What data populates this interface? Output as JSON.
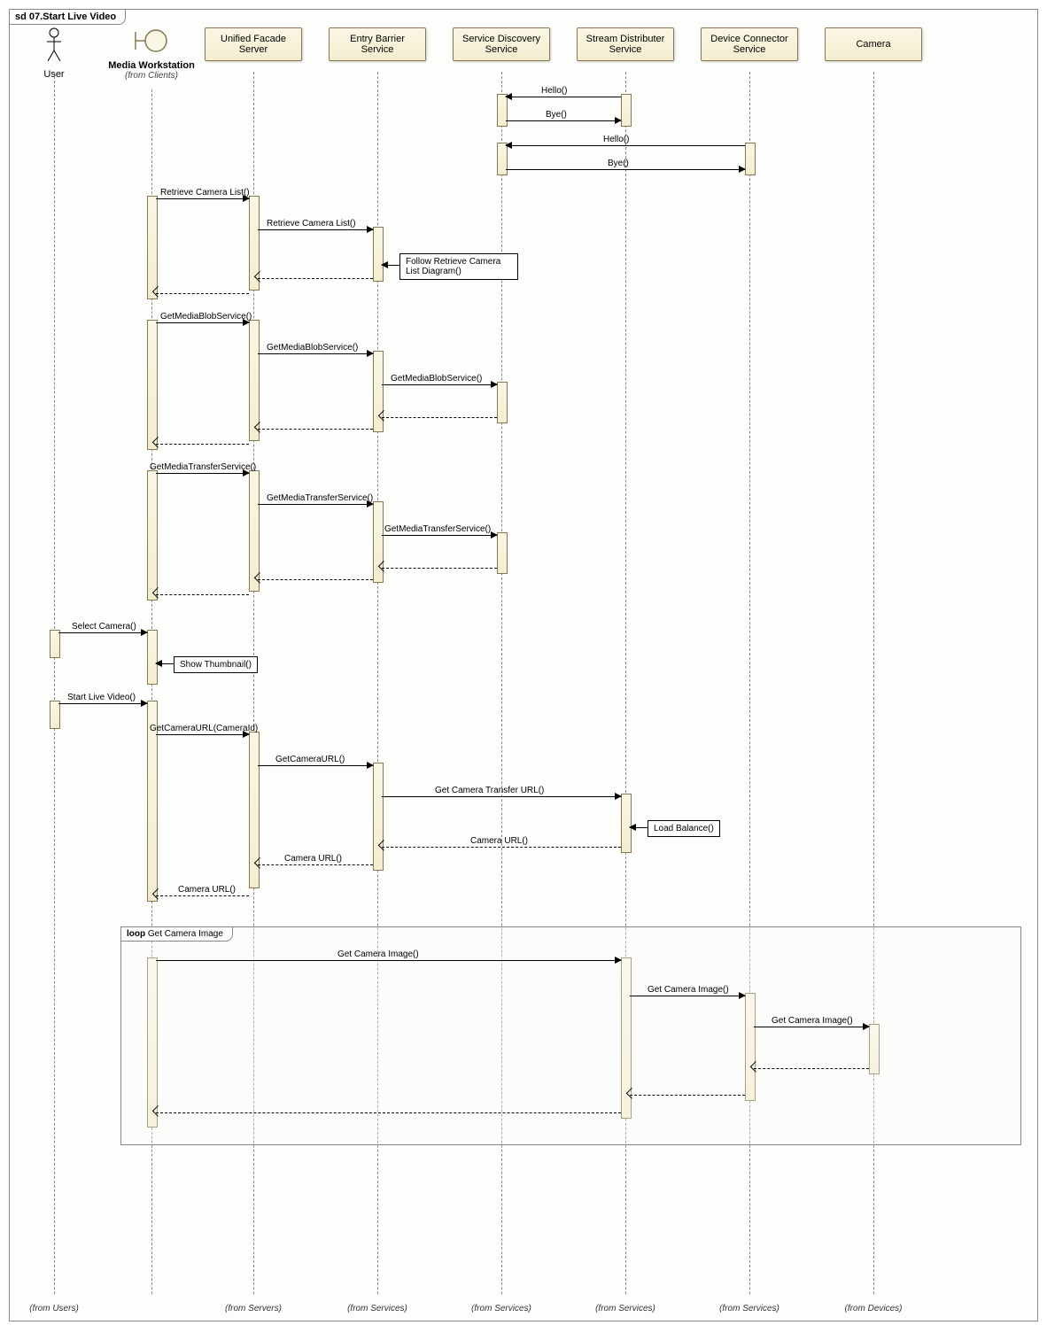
{
  "frame_title": "sd 07.Start Live Video",
  "lifelines": [
    {
      "name": "User",
      "from": "(from Users)"
    },
    {
      "name": "Media Workstation",
      "stereotype": "(from Clients)",
      "from": ""
    },
    {
      "name": "Unified Facade Server",
      "from": "(from Servers)"
    },
    {
      "name": "Entry Barrier Service",
      "from": "(from Services)"
    },
    {
      "name": "Service Discovery Service",
      "from": "(from Services)"
    },
    {
      "name": "Stream Distributer Service",
      "from": "(from Services)"
    },
    {
      "name": "Device Connector Service",
      "from": "(from Services)"
    },
    {
      "name": "Camera",
      "from": "(from Devices)"
    }
  ],
  "messages": {
    "hello1": "Hello()",
    "bye1": "Bye()",
    "hello2": "Hello()",
    "bye2": "Bye()",
    "retrieve1": "Retrieve Camera List()",
    "retrieve2": "Retrieve Camera List()",
    "follow": "Follow Retrieve Camera List Diagram()",
    "getblob1": "GetMediaBlobService()",
    "getblob2": "GetMediaBlobService()",
    "getblob3": "GetMediaBlobService()",
    "gettransfer1": "GetMediaTransferService()",
    "gettransfer2": "GetMediaTransferService()",
    "gettransfer3": "GetMediaTransferService()",
    "selectcam": "Select Camera()",
    "showthumb": "Show Thumbnail()",
    "startlive": "Start Live Video()",
    "getcamurl1": "GetCameraURL(CameraId)",
    "getcamurl2": "GetCameraURL()",
    "getcamtransfer": "Get Camera Transfer URL()",
    "loadbalance": "Load Balance()",
    "camurl1": "Camera URL()",
    "camurl2": "Camera URL()",
    "camurl3": "Camera URL()",
    "loop_title": "loop Get Camera Image",
    "getimg1": "Get Camera Image()",
    "getimg2": "Get Camera Image()",
    "getimg3": "Get Camera Image()"
  }
}
